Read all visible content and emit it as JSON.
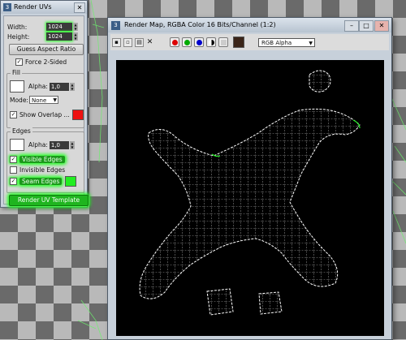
{
  "render_uvs": {
    "title": "Render UVs",
    "width_label": "Width:",
    "width_value": "1024",
    "height_label": "Height:",
    "height_value": "1024",
    "guess_aspect_ratio": "Guess Aspect Ratio",
    "force_two_sided": "Force 2-Sided",
    "fill_group": "Fill",
    "alpha_label": "Alpha:",
    "fill_alpha_value": "1,0",
    "mode_label": "Mode:",
    "mode_value": "None",
    "show_overlap": "Show Overlap ...",
    "overlap_color": "#ee1111",
    "edges_group": "Edges",
    "edges_alpha_value": "1,0",
    "edges_color": "#ffffff",
    "visible_edges": "Visible Edges",
    "invisible_edges": "Invisible Edges",
    "seam_edges": "Seam Edges",
    "seam_color": "#22ee22",
    "render_uv_template": "Render UV Template"
  },
  "render_map": {
    "title": "Render Map, RGBA Color 16 Bits/Channel (1:2)",
    "channel_select": "RGB Alpha",
    "channel_colors": [
      "#dd0000",
      "#00aa00",
      "#0000cc"
    ],
    "swatch_color": "#3a2418"
  },
  "colors": {
    "highlight": "#23ff23",
    "wire": "#ffffff",
    "seam": "#22ee22"
  }
}
